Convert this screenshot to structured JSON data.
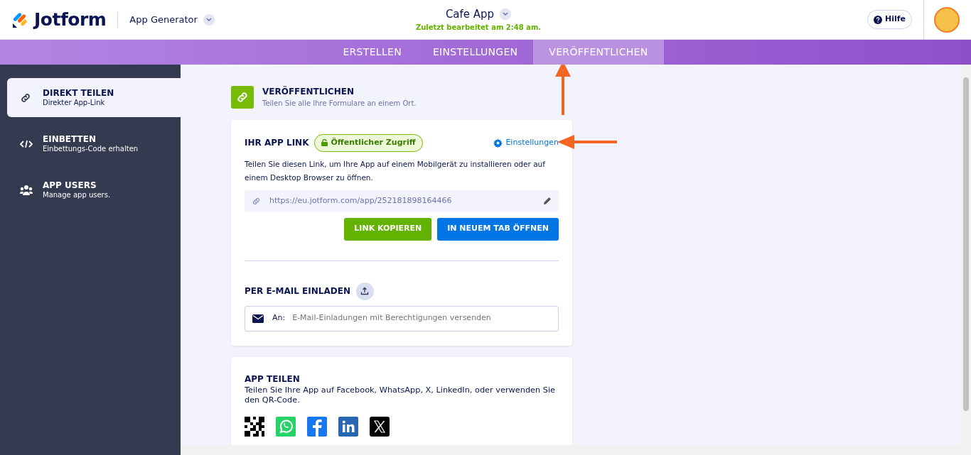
{
  "header": {
    "logo": "Jotform",
    "product": "App Generator",
    "app_title": "Cafe App",
    "last_edited": "Zuletzt bearbeitet am 2:48 am.",
    "help": "Hilfe"
  },
  "tabs": [
    {
      "label": "ERSTELLEN",
      "selected": false
    },
    {
      "label": "EINSTELLUNGEN",
      "selected": false
    },
    {
      "label": "VERÖFFENTLICHEN",
      "selected": true
    }
  ],
  "sidebar": {
    "items": [
      {
        "kind": "link",
        "title": "DIREKT TEILEN",
        "subtitle": "Direkter App-Link",
        "selected": true
      },
      {
        "kind": "embed",
        "title": "EINBETTEN",
        "subtitle": "Einbettungs-Code erhalten",
        "selected": false
      },
      {
        "kind": "users",
        "title": "APP USERS",
        "subtitle": "Manage app users.",
        "selected": false
      }
    ]
  },
  "section": {
    "title": "VERÖFFENTLICHEN",
    "subtitle": "Teilen Sie alle Ihre Formulare an einem Ort."
  },
  "link_card": {
    "title": "IHR APP LINK",
    "badge": "Öffentlicher Zugriff",
    "settings_link": "Einstellungen",
    "description": "Teilen Sie diesen Link, um Ihre App auf einem Mobilgerät zu installieren oder auf einem Desktop Browser zu öffnen.",
    "url": "https://eu.jotform.com/app/252181898164466",
    "buttons": [
      {
        "kind": "success",
        "label": "LINK KOPIEREN"
      },
      {
        "kind": "primary",
        "label": "IN NEUEM TAB ÖFFNEN"
      }
    ]
  },
  "invite": {
    "title": "PER E-MAIL EINLADEN",
    "field_label": "An:",
    "placeholder": "E-Mail-Einladungen mit Berechtigungen versenden"
  },
  "share": {
    "title": "APP TEILEN",
    "description": "Teilen Sie Ihre App auf Facebook, WhatsApp, X, LinkedIn, oder verwenden Sie den QR-Code.",
    "icons": [
      {
        "kind": "qr"
      },
      {
        "kind": "whatsapp"
      },
      {
        "kind": "facebook"
      },
      {
        "kind": "linkedin"
      },
      {
        "kind": "x"
      }
    ]
  }
}
